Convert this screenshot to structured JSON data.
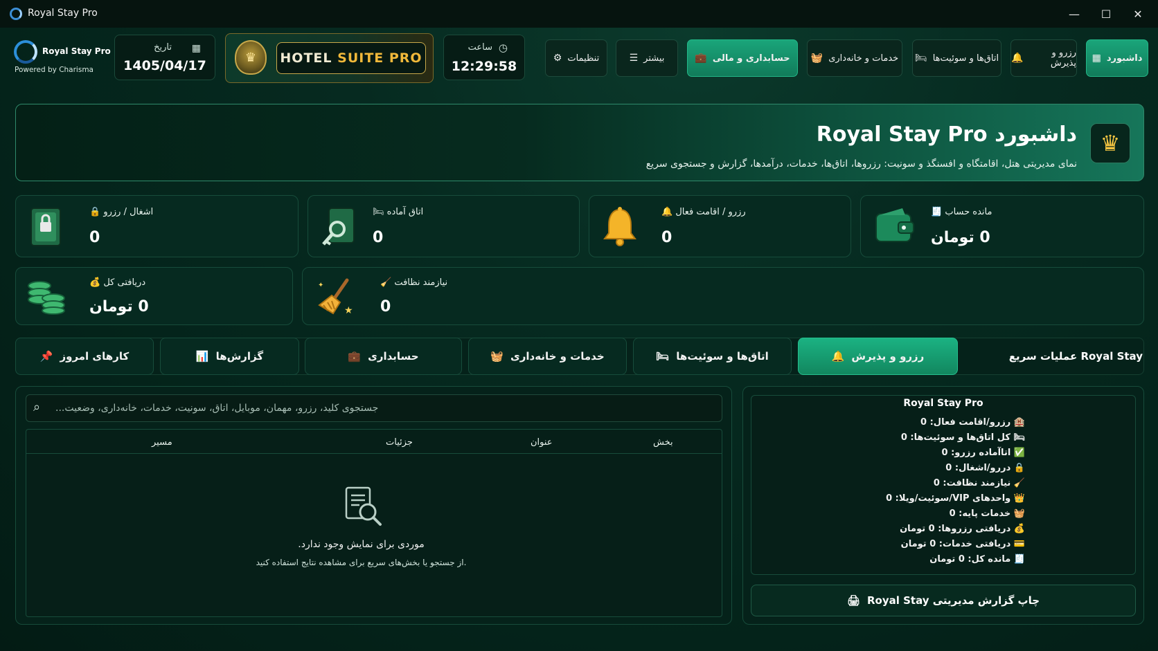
{
  "window": {
    "title": "Royal Stay Pro",
    "controls": [
      "—",
      "☐",
      "✕"
    ]
  },
  "header": {
    "logo_name": "Royal Stay Pro",
    "logo_sub": "Powered by Charisma",
    "date_label": "تاریخ",
    "date_value": "1405/04/17",
    "brand_part1": "HOTEL ",
    "brand_part2": "SUITE PRO",
    "time_label": "ساعت",
    "time_value": "12:29:58",
    "nav": {
      "dashboard": "داشبورد",
      "reservation": "رزرو و پذیرش",
      "rooms": "اتاق‌ها و سوئیت‌ها",
      "services": "خدمات و خانه‌داری",
      "accounting": "حسابداری و مالی",
      "more": "بیشتر",
      "settings": "تنظیمات"
    }
  },
  "hero": {
    "title": "داشبورد Royal Stay Pro",
    "subtitle": "نمای مدیریتی هتل، اقامتگاه و افسنگذ و سونیت: رزروها، اتاق‌ها، خدمات، درآمدها، گزارش و جستجوی سریع"
  },
  "stats": {
    "occupancy": {
      "label": "اشغال / رزرو",
      "value": "0"
    },
    "ready_room": {
      "label": "اتاق آماده",
      "value": "0"
    },
    "active_stay": {
      "label": "رزرو / اقامت فعال",
      "value": "0"
    },
    "balance": {
      "label": "مانده حساب",
      "value": "0 تومان"
    },
    "total_received": {
      "label": "دریافتی کل",
      "value": "0 تومان"
    },
    "cleaning": {
      "label": "نیازمند نظافت",
      "value": "0"
    }
  },
  "quick_ops": {
    "title": "عملیات سریع Royal Stay",
    "tabs": {
      "reservation": "رزرو و پذیرش",
      "rooms": "اتاق‌ها و سوئیت‌ها",
      "services": "خدمات و خانه‌داری",
      "accounting": "حسابداری",
      "reports": "گزارش‌ها",
      "today": "کارهای امروز"
    }
  },
  "search": {
    "placeholder": "جستجوی کلید، رزرو، مهمان، موبایل، اتاق، سونیت، خدمات، خانه‌داری، وضعیت..."
  },
  "table": {
    "columns": [
      "بخش",
      "عنوان",
      "جزئیات",
      "مسیر"
    ],
    "empty_title": "موردی برای نمایش وجود ندارد.",
    "empty_sub": ".از جستجو یا بخش‌های سریع برای مشاهده نتایج استفاده کنید"
  },
  "summary": {
    "title": "Royal Stay Pro",
    "rows": [
      {
        "icon": "🏨",
        "text": "رزرو/اقامت فعال: 0"
      },
      {
        "icon": "🛏",
        "text": "کل اتاق‌ها و سوئیت‌ها: 0"
      },
      {
        "icon": "✅",
        "text": "اتاآماده رزرو: 0"
      },
      {
        "icon": "🔒",
        "text": "دررو/اشغال: 0"
      },
      {
        "icon": "🧹",
        "text": "نیازمند نظافت: 0"
      },
      {
        "icon": "👑",
        "text": "واحدهای VIP/سوئیت/ویلا: 0"
      },
      {
        "icon": "🧺",
        "text": "خدمات پایه: 0"
      },
      {
        "icon": "💰",
        "text": "دریافتی رزروها: 0 تومان"
      },
      {
        "icon": "💳",
        "text": "دریافتی خدمات: 0 تومان"
      },
      {
        "icon": "🧾",
        "text": "مانده کل: 0 تومان"
      }
    ],
    "print_label": "چاپ گزارش مدیریتی Royal Stay"
  },
  "colors": {
    "background": "#041a14",
    "accent": "#17a077",
    "gold": "#f0b83a"
  }
}
